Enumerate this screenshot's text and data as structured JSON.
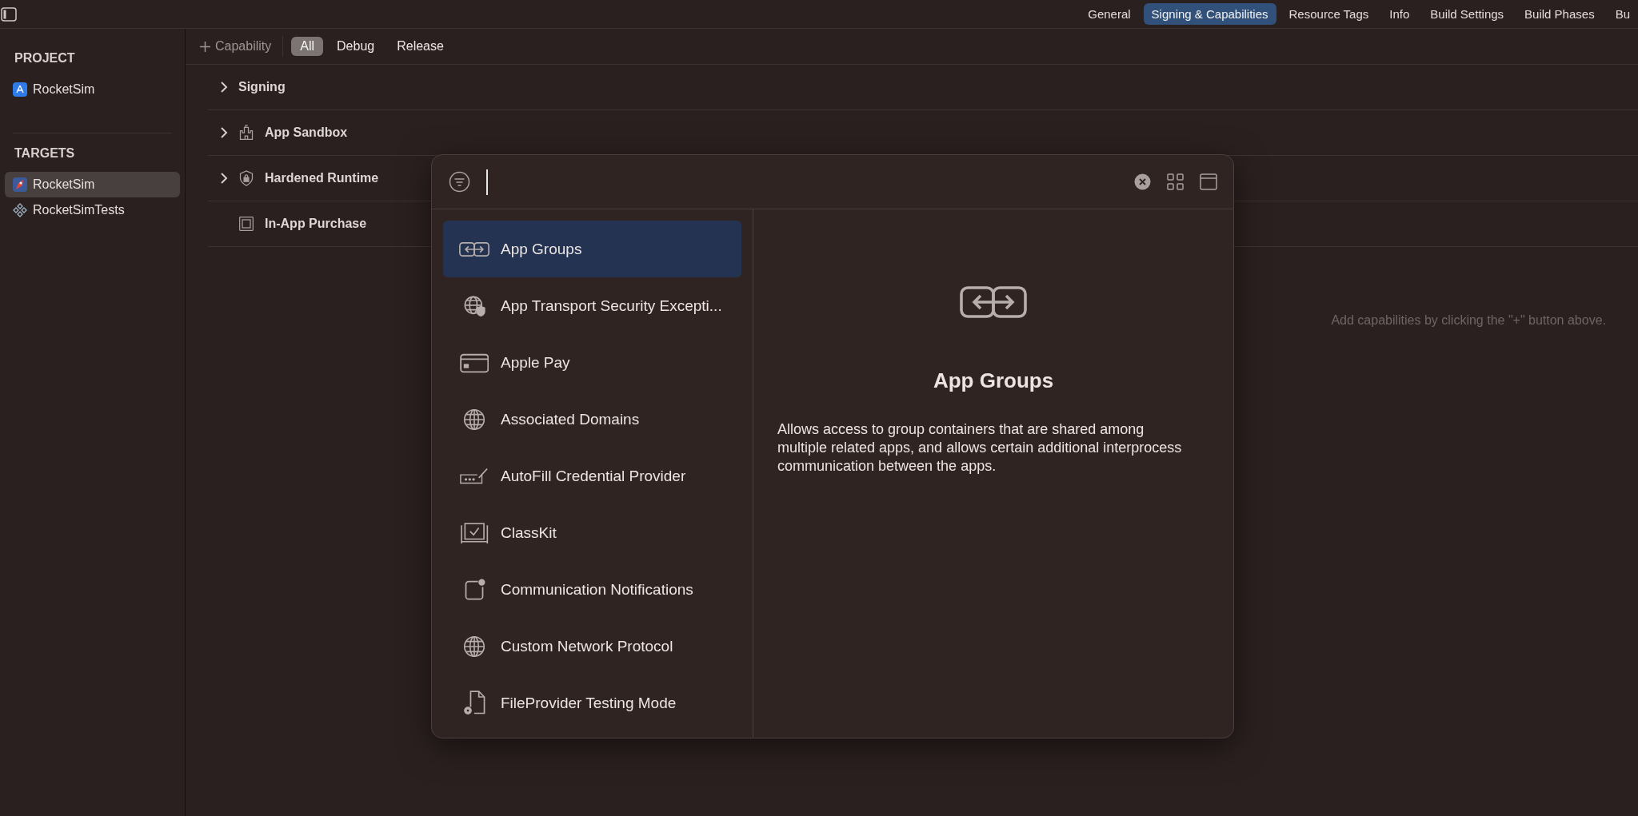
{
  "toolbar": {
    "tabs": [
      {
        "label": "General",
        "selected": false
      },
      {
        "label": "Signing & Capabilities",
        "selected": true
      },
      {
        "label": "Resource Tags",
        "selected": false
      },
      {
        "label": "Info",
        "selected": false
      },
      {
        "label": "Build Settings",
        "selected": false
      },
      {
        "label": "Build Phases",
        "selected": false
      },
      {
        "label": "Bu",
        "selected": false
      }
    ]
  },
  "sidebar": {
    "sections": [
      {
        "title": "PROJECT",
        "items": [
          {
            "label": "RocketSim",
            "kind": "project",
            "selected": false
          }
        ]
      },
      {
        "title": "TARGETS",
        "items": [
          {
            "label": "RocketSim",
            "kind": "app",
            "selected": true
          },
          {
            "label": "RocketSimTests",
            "kind": "tests",
            "selected": false
          }
        ]
      }
    ]
  },
  "capability_bar": {
    "add_button": "Capability",
    "filters": [
      {
        "label": "All",
        "selected": true
      },
      {
        "label": "Debug",
        "selected": false
      },
      {
        "label": "Release",
        "selected": false
      }
    ]
  },
  "capabilities": [
    {
      "name": "Signing",
      "kind": "signing",
      "expandable": true
    },
    {
      "name": "App Sandbox",
      "kind": "sandbox",
      "expandable": true
    },
    {
      "name": "Hardened Runtime",
      "kind": "runtime",
      "expandable": true
    },
    {
      "name": "In-App Purchase",
      "kind": "purchase",
      "expandable": false
    }
  ],
  "empty_hint": "Add capabilities by clicking the \"+\" button above.",
  "library": {
    "items": [
      {
        "label": "App Groups",
        "kind": "groups",
        "selected": true
      },
      {
        "label": "App Transport Security Excepti...",
        "kind": "transport",
        "selected": false
      },
      {
        "label": "Apple Pay",
        "kind": "pay",
        "selected": false
      },
      {
        "label": "Associated Domains",
        "kind": "globe",
        "selected": false
      },
      {
        "label": "AutoFill Credential Provider",
        "kind": "autofill",
        "selected": false
      },
      {
        "label": "ClassKit",
        "kind": "classkit",
        "selected": false
      },
      {
        "label": "Communication Notifications",
        "kind": "notification",
        "selected": false
      },
      {
        "label": "Custom Network Protocol",
        "kind": "network",
        "selected": false
      },
      {
        "label": "FileProvider Testing Mode",
        "kind": "file",
        "selected": false
      }
    ],
    "detail": {
      "kind": "groups",
      "title": "App Groups",
      "description": "Allows access to group containers that are shared among multiple related apps, and allows certain additional interprocess communication between the apps."
    }
  }
}
